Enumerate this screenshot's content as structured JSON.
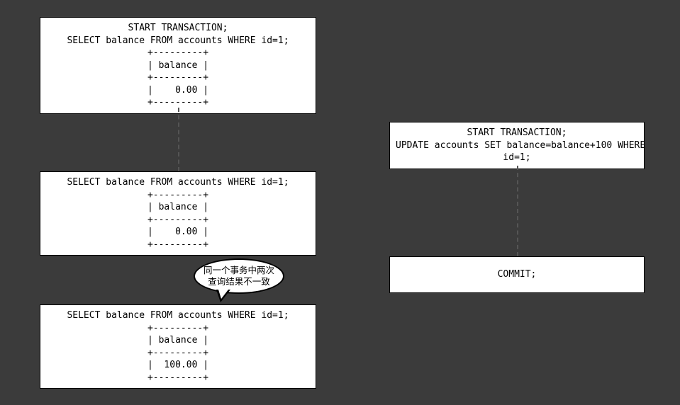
{
  "left": {
    "box1": "START TRANSACTION;\nSELECT balance FROM accounts WHERE id=1;\n+---------+\n| balance |\n+---------+\n|    0.00 |\n+---------+",
    "box2": "SELECT balance FROM accounts WHERE id=1;\n+---------+\n| balance |\n+---------+\n|    0.00 |\n+---------+",
    "box3": "SELECT balance FROM accounts WHERE id=1;\n+---------+\n| balance |\n+---------+\n|  100.00 |\n+---------+"
  },
  "right": {
    "box1": "START TRANSACTION;\nUPDATE accounts SET balance=balance+100 WHERE\nid=1;",
    "box2": "COMMIT;"
  },
  "annotation": {
    "bubble": "同一个事务中两次\n查询结果不一致"
  }
}
